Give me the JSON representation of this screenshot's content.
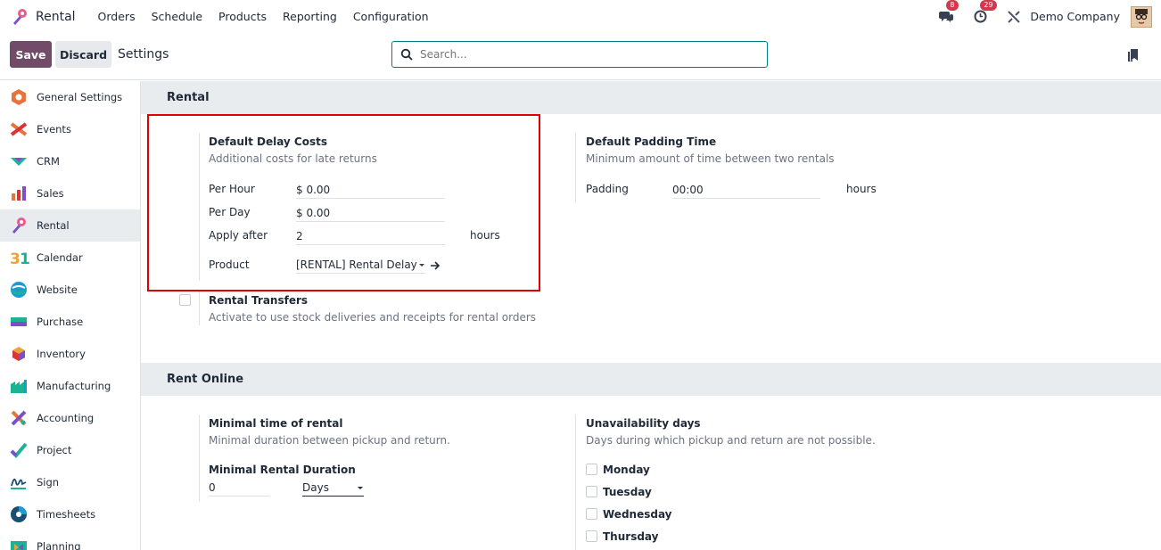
{
  "navbar": {
    "app_name": "Rental",
    "menu": [
      "Orders",
      "Schedule",
      "Products",
      "Reporting",
      "Configuration"
    ],
    "messages_count": "8",
    "activities_count": "29",
    "company": "Demo Company"
  },
  "control_panel": {
    "save_label": "Save",
    "discard_label": "Discard",
    "title": "Settings",
    "search_placeholder": "Search..."
  },
  "sidebar": {
    "items": [
      {
        "label": "General Settings",
        "icon": "general-settings-icon"
      },
      {
        "label": "Events",
        "icon": "events-icon"
      },
      {
        "label": "CRM",
        "icon": "crm-icon"
      },
      {
        "label": "Sales",
        "icon": "sales-icon"
      },
      {
        "label": "Rental",
        "icon": "rental-icon",
        "active": true
      },
      {
        "label": "Calendar",
        "icon": "calendar-icon"
      },
      {
        "label": "Website",
        "icon": "website-icon"
      },
      {
        "label": "Purchase",
        "icon": "purchase-icon"
      },
      {
        "label": "Inventory",
        "icon": "inventory-icon"
      },
      {
        "label": "Manufacturing",
        "icon": "manufacturing-icon"
      },
      {
        "label": "Accounting",
        "icon": "accounting-icon"
      },
      {
        "label": "Project",
        "icon": "project-icon"
      },
      {
        "label": "Sign",
        "icon": "sign-icon"
      },
      {
        "label": "Timesheets",
        "icon": "timesheets-icon"
      },
      {
        "label": "Planning",
        "icon": "planning-icon"
      }
    ]
  },
  "rental": {
    "header": "Rental",
    "delay_costs": {
      "title": "Default Delay Costs",
      "desc": "Additional costs for late returns",
      "per_hour_label": "Per Hour",
      "per_hour_value": "$ 0.00",
      "per_day_label": "Per Day",
      "per_day_value": "$ 0.00",
      "apply_after_label": "Apply after",
      "apply_after_value": "2",
      "apply_after_unit": "hours",
      "product_label": "Product",
      "product_value": "[RENTAL] Rental Delay"
    },
    "padding": {
      "title": "Default Padding Time",
      "desc": "Minimum amount of time between two rentals",
      "label": "Padding",
      "value": "00:00",
      "unit": "hours"
    },
    "transfers": {
      "title": "Rental Transfers",
      "desc": "Activate to use stock deliveries and receipts for rental orders"
    }
  },
  "rent_online": {
    "header": "Rent Online",
    "minimal_time": {
      "title": "Minimal time of rental",
      "desc": "Minimal duration between pickup and return.",
      "duration_label": "Minimal Rental Duration",
      "duration_value": "0",
      "duration_unit": "Days"
    },
    "unavailability": {
      "title": "Unavailability days",
      "desc": "Days during which pickup and return are not possible.",
      "days": [
        "Monday",
        "Tuesday",
        "Wednesday",
        "Thursday"
      ]
    }
  },
  "colors": {
    "primary": "#714b67",
    "accent": "#017e84",
    "highlight": "#e00000"
  }
}
